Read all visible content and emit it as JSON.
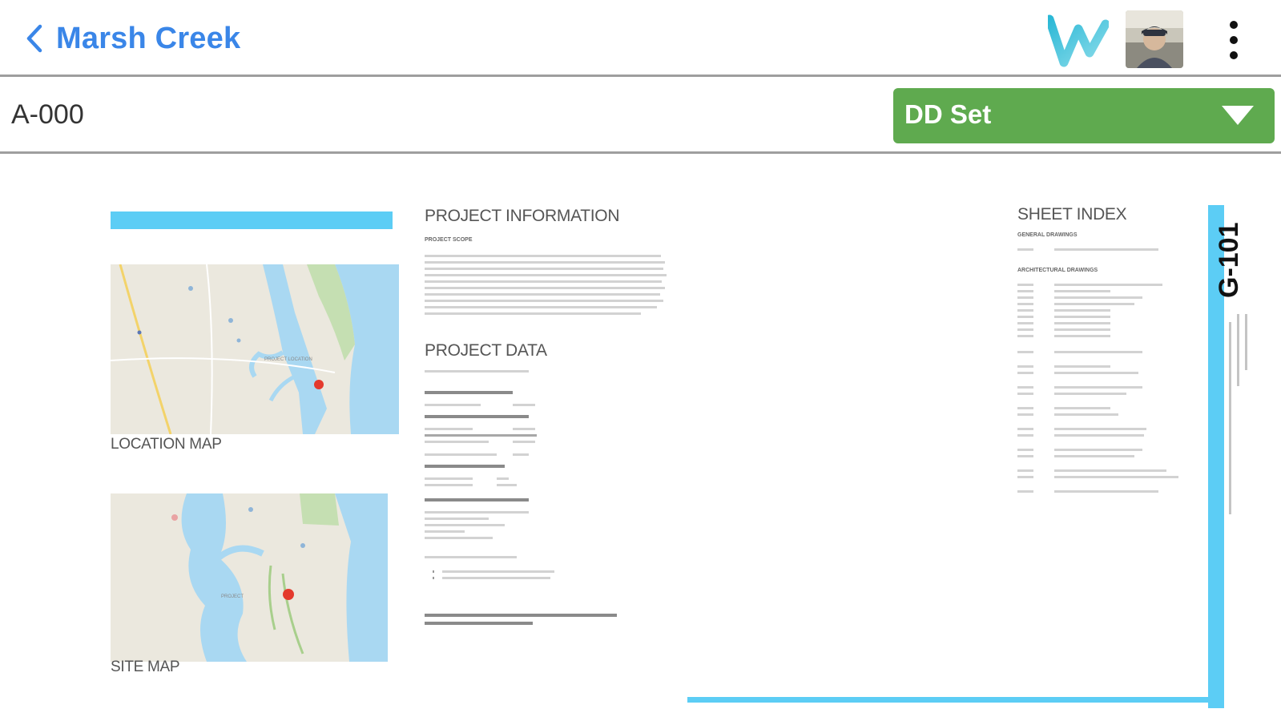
{
  "header": {
    "back_label": "Marsh Creek",
    "logo_icon": "w-logo-icon",
    "avatar_icon": "user-avatar",
    "menu_icon": "more-vertical-icon"
  },
  "subbar": {
    "sheet_id": "A-000",
    "set_selected": "DD Set"
  },
  "sheet": {
    "project_information_heading": "PROJECT INFORMATION",
    "project_scope_label": "PROJECT SCOPE",
    "project_data_heading": "PROJECT DATA",
    "sheet_index_heading": "SHEET INDEX",
    "general_drawings_label": "GENERAL DRAWINGS",
    "architectural_drawings_label": "ARCHITECTURAL DRAWINGS",
    "location_map_label": "LOCATION MAP",
    "site_map_label": "SITE MAP",
    "sheet_number": "G-101",
    "location_marker_label": "PROJECT LOCATION",
    "site_marker_label": "PROJECT"
  },
  "colors": {
    "link_blue": "#3a86e8",
    "set_green": "#5faa4f",
    "sheet_cyan": "#5ccdf5"
  }
}
